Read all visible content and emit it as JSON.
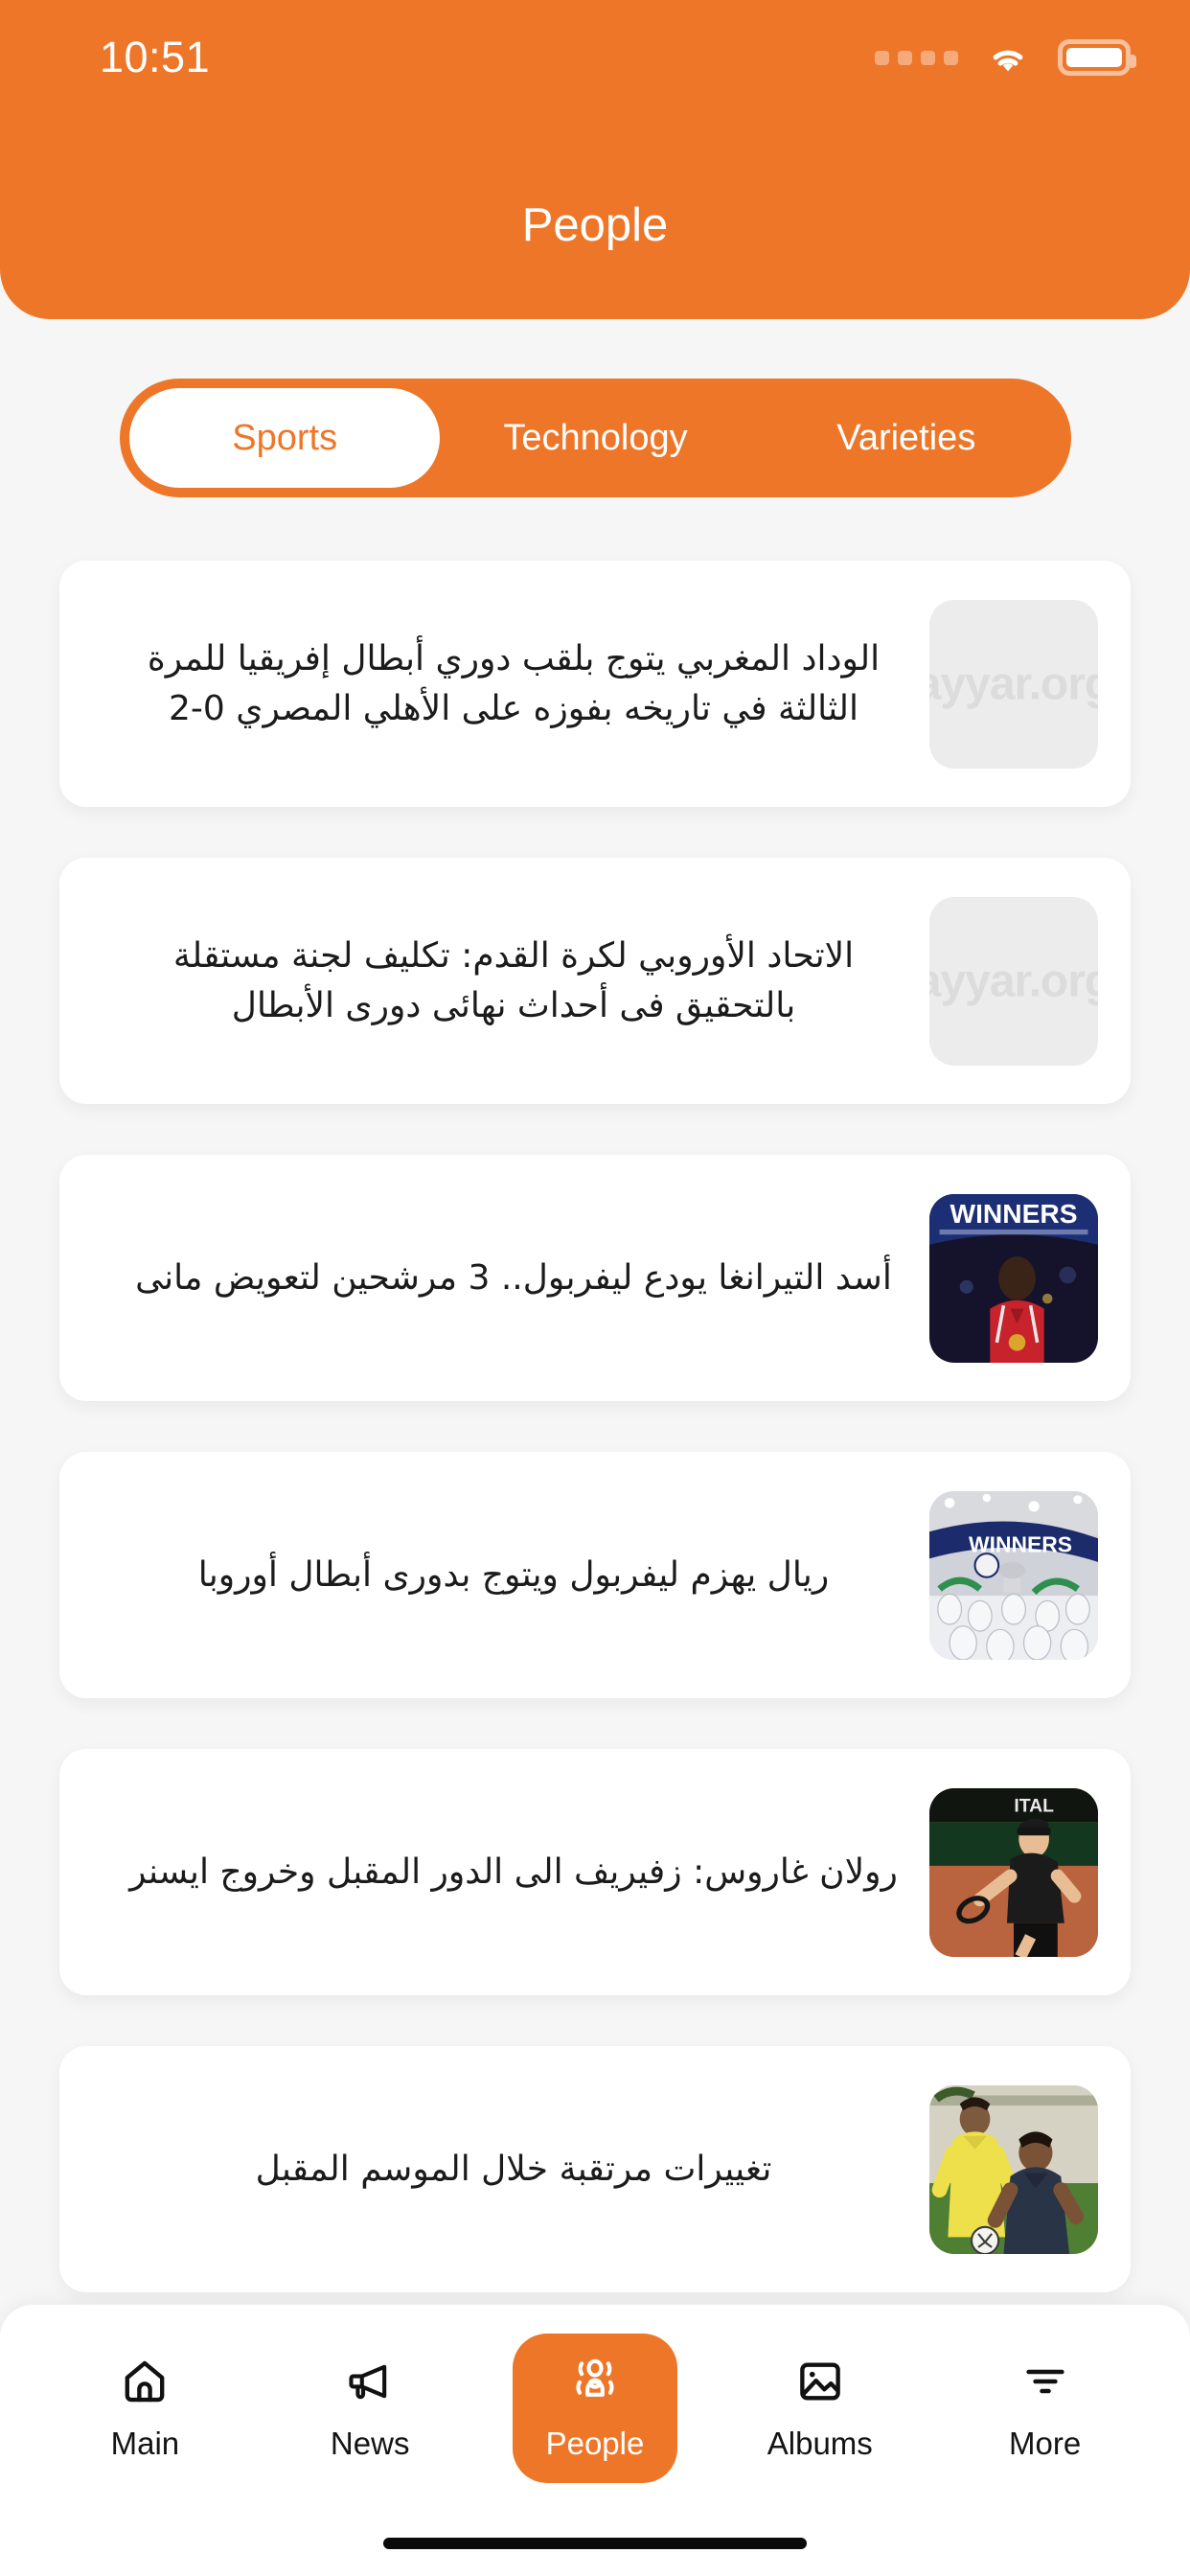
{
  "status_bar": {
    "time": "10:51",
    "signal_icon": "signal-dots-icon",
    "wifi_icon": "wifi-icon",
    "battery_icon": "battery-icon"
  },
  "header": {
    "title": "People",
    "background_color": "#ee7629"
  },
  "category_tabs": {
    "active_index": 0,
    "items": [
      {
        "label": "Sports",
        "active": true
      },
      {
        "label": "Technology",
        "active": false
      },
      {
        "label": "Varieties",
        "active": false
      }
    ]
  },
  "feed": {
    "items": [
      {
        "title": "الوداد المغربي يتوج بلقب دوري أبطال إفريقيا للمرة الثالثة في تاريخه بفوزه على الأهلي المصري 0-2",
        "thumbnail": "placeholder",
        "placeholder_text": "ayyar.org"
      },
      {
        "title": "الاتحاد الأوروبي لكرة القدم: تكليف لجنة مستقلة بالتحقيق فى أحداث نهائى دورى الأبطال",
        "thumbnail": "placeholder",
        "placeholder_text": "ayyar.org"
      },
      {
        "title": "أسد التيرانغا يودع ليفربول.. 3 مرشحين لتعويض مانى",
        "thumbnail": "photo-mane-winners"
      },
      {
        "title": "ريال يهزم ليفربول ويتوج بدورى أبطال أوروبا",
        "thumbnail": "photo-real-madrid-winners"
      },
      {
        "title": "رولان غاروس: زفيريف الى الدور المقبل وخروج ايسنر",
        "thumbnail": "photo-tennis-zverev"
      },
      {
        "title": "تغييرات مرتقبة خلال الموسم المقبل",
        "thumbnail": "photo-football-players"
      }
    ]
  },
  "bottom_nav": {
    "active_index": 2,
    "items": [
      {
        "label": "Main",
        "icon": "home-icon",
        "active": false
      },
      {
        "label": "News",
        "icon": "megaphone-icon",
        "active": false
      },
      {
        "label": "People",
        "icon": "people-icon",
        "active": true
      },
      {
        "label": "Albums",
        "icon": "image-icon",
        "active": false
      },
      {
        "label": "More",
        "icon": "filter-icon",
        "active": false
      }
    ]
  }
}
